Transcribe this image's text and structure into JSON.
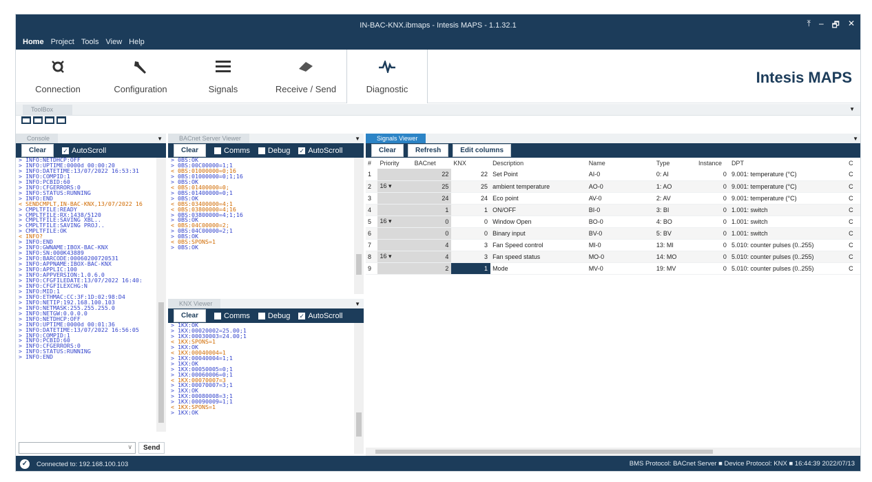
{
  "window": {
    "title": "IN-BAC-KNX.ibmaps - Intesis MAPS - 1.1.32.1",
    "controls": [
      "⤒",
      "–",
      "🗗",
      "✕"
    ]
  },
  "menu": [
    "Home",
    "Project",
    "Tools",
    "View",
    "Help"
  ],
  "ribbon": [
    {
      "label": "Connection",
      "icon": "connection-icon"
    },
    {
      "label": "Configuration",
      "icon": "wrench-icon"
    },
    {
      "label": "Signals",
      "icon": "list-icon"
    },
    {
      "label": "Receive / Send",
      "icon": "transfer-icon"
    },
    {
      "label": "Diagnostic",
      "icon": "pulse-icon"
    }
  ],
  "brand": "Intesis MAPS",
  "toolbox": {
    "label": "ToolBox"
  },
  "console": {
    "tab": "Console",
    "clear": "Clear",
    "autoscroll": "AutoScroll",
    "send": "Send",
    "lines": [
      {
        "t": "> INFO:NETDHCP:OFF",
        "c": "b"
      },
      {
        "t": "> INFO:UPTIME:0000d 00:00:20",
        "c": "b"
      },
      {
        "t": "> INFO:DATETIME:13/07/2022 16:53:31",
        "c": "b"
      },
      {
        "t": "> INFO:COMPID:1",
        "c": "b"
      },
      {
        "t": "> INFO:PCBID:60",
        "c": "b"
      },
      {
        "t": "> INFO:CFGERRORS:0",
        "c": "b"
      },
      {
        "t": "> INFO:STATUS:RUNNING",
        "c": "b"
      },
      {
        "t": "> INFO:END",
        "c": "b"
      },
      {
        "t": "< SENDCMPLT,IN-BAC-KNX,13/07/2022 16",
        "c": "o"
      },
      {
        "t": "> CMPLTFILE:READY",
        "c": "b"
      },
      {
        "t": "> CMPLTFILE:RX:1438/5120",
        "c": "b"
      },
      {
        "t": "> CMPLTFILE:SAVING XBL..",
        "c": "b"
      },
      {
        "t": "> CMPLTFILE:SAVING PROJ..",
        "c": "b"
      },
      {
        "t": "> CMPLTFILE:OK",
        "c": "b"
      },
      {
        "t": "< INFO?",
        "c": "o"
      },
      {
        "t": "> INFO:END",
        "c": "b"
      },
      {
        "t": "> INFO:GWNAME:IBOX-BAC-KNX",
        "c": "b"
      },
      {
        "t": "> INFO:SN:000K43889",
        "c": "b"
      },
      {
        "t": "> INFO:BARCODE:00060200720531",
        "c": "b"
      },
      {
        "t": "> INFO:APPNAME:IBOX-BAC-KNX",
        "c": "b"
      },
      {
        "t": "> INFO:APPLIC:100",
        "c": "b"
      },
      {
        "t": "> INFO:APPVERSION:1.0.6.0",
        "c": "b"
      },
      {
        "t": "> INFO:CFGFILEDATE:13/07/2022 16:40:",
        "c": "b"
      },
      {
        "t": "> INFO:CFGFILEXCHG:N",
        "c": "b"
      },
      {
        "t": "> INFO:MID:1",
        "c": "b"
      },
      {
        "t": "> INFO:ETHMAC:CC:3F:1D:02:98:D4",
        "c": "b"
      },
      {
        "t": "> INFO:NETIP:192.168.100.103",
        "c": "b"
      },
      {
        "t": "> INFO:NETMASK:255.255.255.0",
        "c": "b"
      },
      {
        "t": "> INFO:NETGW:0.0.0.0",
        "c": "b"
      },
      {
        "t": "> INFO:NETDHCP:OFF",
        "c": "b"
      },
      {
        "t": "> INFO:UPTIME:0000d 00:01:36",
        "c": "b"
      },
      {
        "t": "> INFO:DATETIME:13/07/2022 16:56:05",
        "c": "b"
      },
      {
        "t": "> INFO:COMPID:1",
        "c": "b"
      },
      {
        "t": "> INFO:PCBID:60",
        "c": "b"
      },
      {
        "t": "> INFO:CFGERRORS:0",
        "c": "b"
      },
      {
        "t": "> INFO:STATUS:RUNNING",
        "c": "b"
      },
      {
        "t": "> INFO:END",
        "c": "b"
      }
    ]
  },
  "bacnet": {
    "tab": "BACnet Server Viewer",
    "clear": "Clear",
    "comms": "Comms",
    "debug": "Debug",
    "autoscroll": "AutoScroll",
    "lines": [
      {
        "t": "> 0BS:OK",
        "c": "b"
      },
      {
        "t": "> 0BS:00C00000=1;1",
        "c": "b"
      },
      {
        "t": "< 0BS:01000000=0;16",
        "c": "o"
      },
      {
        "t": "> 0BS:01000000=0;1;16",
        "c": "b"
      },
      {
        "t": "> 0BS:OK",
        "c": "b"
      },
      {
        "t": "< 0BS:01400000=0;",
        "c": "o"
      },
      {
        "t": "> 0BS:01400000=0;1",
        "c": "b"
      },
      {
        "t": "> 0BS:OK",
        "c": "b"
      },
      {
        "t": "< 0BS:03400000=4;1",
        "c": "o"
      },
      {
        "t": "< 0BS:03800000=4;16",
        "c": "o"
      },
      {
        "t": "> 0BS:03800000=4;1;16",
        "c": "b"
      },
      {
        "t": "> 0BS:OK",
        "c": "b"
      },
      {
        "t": "< 0BS:04C00000=2;",
        "c": "o"
      },
      {
        "t": "> 0BS:04C00000=2;1",
        "c": "b"
      },
      {
        "t": "> 0BS:OK",
        "c": "b"
      },
      {
        "t": "< 0BS:SPONS=1",
        "c": "o"
      },
      {
        "t": "> 0BS:OK",
        "c": "b"
      }
    ]
  },
  "knx": {
    "tab": "KNX Viewer",
    "clear": "Clear",
    "comms": "Comms",
    "debug": "Debug",
    "autoscroll": "AutoScroll",
    "lines": [
      {
        "t": "> 1KX:OK",
        "c": "b"
      },
      {
        "t": "> 1KX:00020002=25.00;1",
        "c": "b"
      },
      {
        "t": "> 1KX:00030003=24.00;1",
        "c": "b"
      },
      {
        "t": "< 1KX:SPONS=1",
        "c": "o"
      },
      {
        "t": "> 1KX:OK",
        "c": "b"
      },
      {
        "t": "< 1KX:00040004=1",
        "c": "o"
      },
      {
        "t": "> 1KX:00040004=1;1",
        "c": "b"
      },
      {
        "t": "> 1KX:OK",
        "c": "b"
      },
      {
        "t": "> 1KX:00050005=0;1",
        "c": "b"
      },
      {
        "t": "> 1KX:00060006=0;1",
        "c": "b"
      },
      {
        "t": "< 1KX:00070007=3",
        "c": "o"
      },
      {
        "t": "> 1KX:00070007=3;1",
        "c": "b"
      },
      {
        "t": "> 1KX:OK",
        "c": "b"
      },
      {
        "t": "> 1KX:00080008=3;1",
        "c": "b"
      },
      {
        "t": "> 1KX:00090009=1;1",
        "c": "b"
      },
      {
        "t": "< 1KX:SPONS=1",
        "c": "o"
      },
      {
        "t": "> 1KX:OK",
        "c": "b"
      }
    ]
  },
  "signals": {
    "tab": "Signals Viewer",
    "clear": "Clear",
    "refresh": "Refresh",
    "edit": "Edit columns",
    "headers": [
      "#",
      "Priority",
      "BACnet",
      "KNX",
      "Description",
      "Name",
      "Type",
      "Instance",
      "DPT",
      "C"
    ],
    "rows": [
      {
        "n": "1",
        "prio": "",
        "bac": "22",
        "knx": "22",
        "desc": "Set Point",
        "name": "AI-0",
        "type": "0: AI",
        "inst": "0",
        "dpt": "9.001: temperature (°C)",
        "c": "C"
      },
      {
        "n": "2",
        "prio": "16 ▾",
        "bac": "25",
        "knx": "25",
        "desc": "ambient temperature",
        "name": "AO-0",
        "type": "1: AO",
        "inst": "0",
        "dpt": "9.001: temperature (°C)",
        "c": "C"
      },
      {
        "n": "3",
        "prio": "",
        "bac": "24",
        "knx": "24",
        "desc": "Eco point",
        "name": "AV-0",
        "type": "2: AV",
        "inst": "0",
        "dpt": "9.001: temperature (°C)",
        "c": "C"
      },
      {
        "n": "4",
        "prio": "",
        "bac": "1",
        "knx": "1",
        "desc": "ON/OFF",
        "name": "BI-0",
        "type": "3: BI",
        "inst": "0",
        "dpt": "1.001: switch",
        "c": "C"
      },
      {
        "n": "5",
        "prio": "16 ▾",
        "bac": "0",
        "knx": "0",
        "desc": "Window Open",
        "name": "BO-0",
        "type": "4: BO",
        "inst": "0",
        "dpt": "1.001: switch",
        "c": "C"
      },
      {
        "n": "6",
        "prio": "",
        "bac": "0",
        "knx": "0",
        "desc": "Binary input",
        "name": "BV-0",
        "type": "5: BV",
        "inst": "0",
        "dpt": "1.001: switch",
        "c": "C"
      },
      {
        "n": "7",
        "prio": "",
        "bac": "4",
        "knx": "3",
        "desc": "Fan Speed control",
        "name": "MI-0",
        "type": "13: MI",
        "inst": "0",
        "dpt": "5.010: counter pulses (0..255)",
        "c": "C"
      },
      {
        "n": "8",
        "prio": "16 ▾",
        "bac": "4",
        "knx": "3",
        "desc": "Fan speed status",
        "name": "MO-0",
        "type": "14: MO",
        "inst": "0",
        "dpt": "5.010: counter pulses (0..255)",
        "c": "C"
      },
      {
        "n": "9",
        "prio": "",
        "bac": "2",
        "knx": "1",
        "desc": "Mode",
        "name": "MV-0",
        "type": "19: MV",
        "inst": "0",
        "dpt": "5.010: counter pulses (0..255)",
        "c": "C"
      }
    ]
  },
  "status": {
    "connected": "Connected to: 192.168.100.103",
    "right": "BMS Protocol: BACnet Server  ■  Device Protocol: KNX  ■  16:44:39 2022/07/13"
  }
}
